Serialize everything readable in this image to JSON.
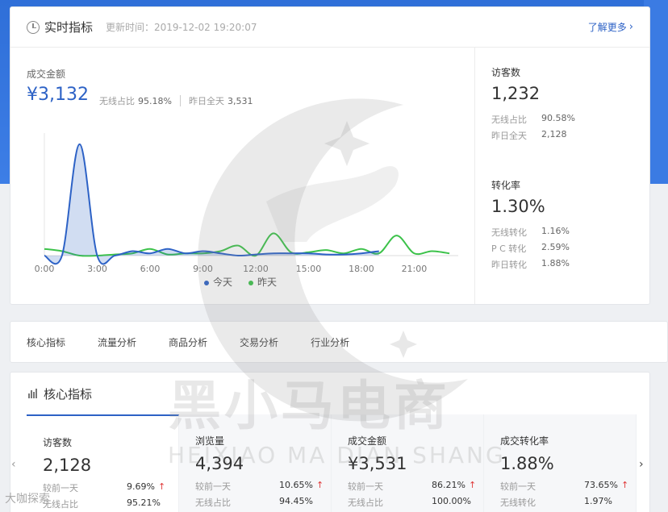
{
  "realtime": {
    "title": "实时指标",
    "updated": "更新时间：2019-12-02 19:20:07",
    "learn_more": "了解更多",
    "gmv_label": "成交金额",
    "gmv_value": "¥3,132",
    "wireless_ratio_label": "无线占比",
    "wireless_ratio_value": "95.18%",
    "yesterday_label": "昨日全天",
    "yesterday_value": "3,531",
    "legend_today": "今天",
    "legend_yesterday": "昨天"
  },
  "right_panel": {
    "visitors_label": "访客数",
    "visitors_value": "1,232",
    "visitors_wireless_label": "无线占比",
    "visitors_wireless_value": "90.58%",
    "visitors_yesterday_label": "昨日全天",
    "visitors_yesterday_value": "2,128",
    "conv_label": "转化率",
    "conv_value": "1.30%",
    "conv_wireless_label": "无线转化",
    "conv_wireless_value": "1.16%",
    "conv_pc_label": "P C 转化",
    "conv_pc_value": "2.59%",
    "conv_yesterday_label": "昨日转化",
    "conv_yesterday_value": "1.88%"
  },
  "tabs": [
    "核心指标",
    "流量分析",
    "商品分析",
    "交易分析",
    "行业分析"
  ],
  "core": {
    "title": "核心指标",
    "cells": [
      {
        "label": "访客数",
        "value": "2,128",
        "cmp_label": "较前一天",
        "cmp_value": "9.69%",
        "sub_label": "无线占比",
        "sub_value": "95.21%"
      },
      {
        "label": "浏览量",
        "value": "4,394",
        "cmp_label": "较前一天",
        "cmp_value": "10.65%",
        "sub_label": "无线占比",
        "sub_value": "94.45%"
      },
      {
        "label": "成交金额",
        "value": "¥3,531",
        "cmp_label": "较前一天",
        "cmp_value": "86.21%",
        "sub_label": "无线占比",
        "sub_value": "100.00%"
      },
      {
        "label": "成交转化率",
        "value": "1.88%",
        "cmp_label": "较前一天",
        "cmp_value": "73.65%",
        "sub_label": "无线转化",
        "sub_value": "1.97%"
      }
    ]
  },
  "watermark": {
    "cn": "黑小马电商",
    "en": "HEIXIAO MA DIAN SHANG"
  },
  "corner_logo": "大咖探索",
  "icons": {
    "clock": "clock-icon",
    "chevron_right": "chevron-right-icon",
    "bar_chart": "bar-chart-icon",
    "arrow_up": "arrow-up-icon",
    "pager_left": "chevron-left-icon",
    "pager_right": "chevron-right-icon"
  },
  "colors": {
    "accent": "#2d62c6",
    "today": "#2d62c6",
    "yesterday": "#3cc24a",
    "up": "#e03a3a",
    "banner": "#3674dd"
  },
  "chart_data": {
    "type": "line",
    "x_ticks": [
      "0:00",
      "3:00",
      "6:00",
      "9:00",
      "12:00",
      "15:00",
      "18:00",
      "21:00"
    ],
    "x": [
      0,
      1,
      2,
      3,
      4,
      5,
      6,
      7,
      8,
      9,
      10,
      11,
      12,
      13,
      14,
      15,
      16,
      17,
      18,
      19,
      20,
      21,
      22,
      23
    ],
    "series": [
      {
        "name": "今天",
        "values": [
          0,
          0,
          1000,
          0,
          0,
          40,
          20,
          60,
          20,
          40,
          20,
          0,
          10,
          20,
          20,
          20,
          10,
          10,
          20,
          40,
          null,
          null,
          null,
          null
        ]
      },
      {
        "name": "昨天",
        "values": [
          60,
          40,
          0,
          0,
          10,
          20,
          60,
          10,
          20,
          20,
          40,
          90,
          0,
          200,
          30,
          30,
          50,
          20,
          60,
          20,
          180,
          20,
          40,
          20
        ]
      }
    ],
    "ylim": [
      0,
      1100
    ]
  }
}
